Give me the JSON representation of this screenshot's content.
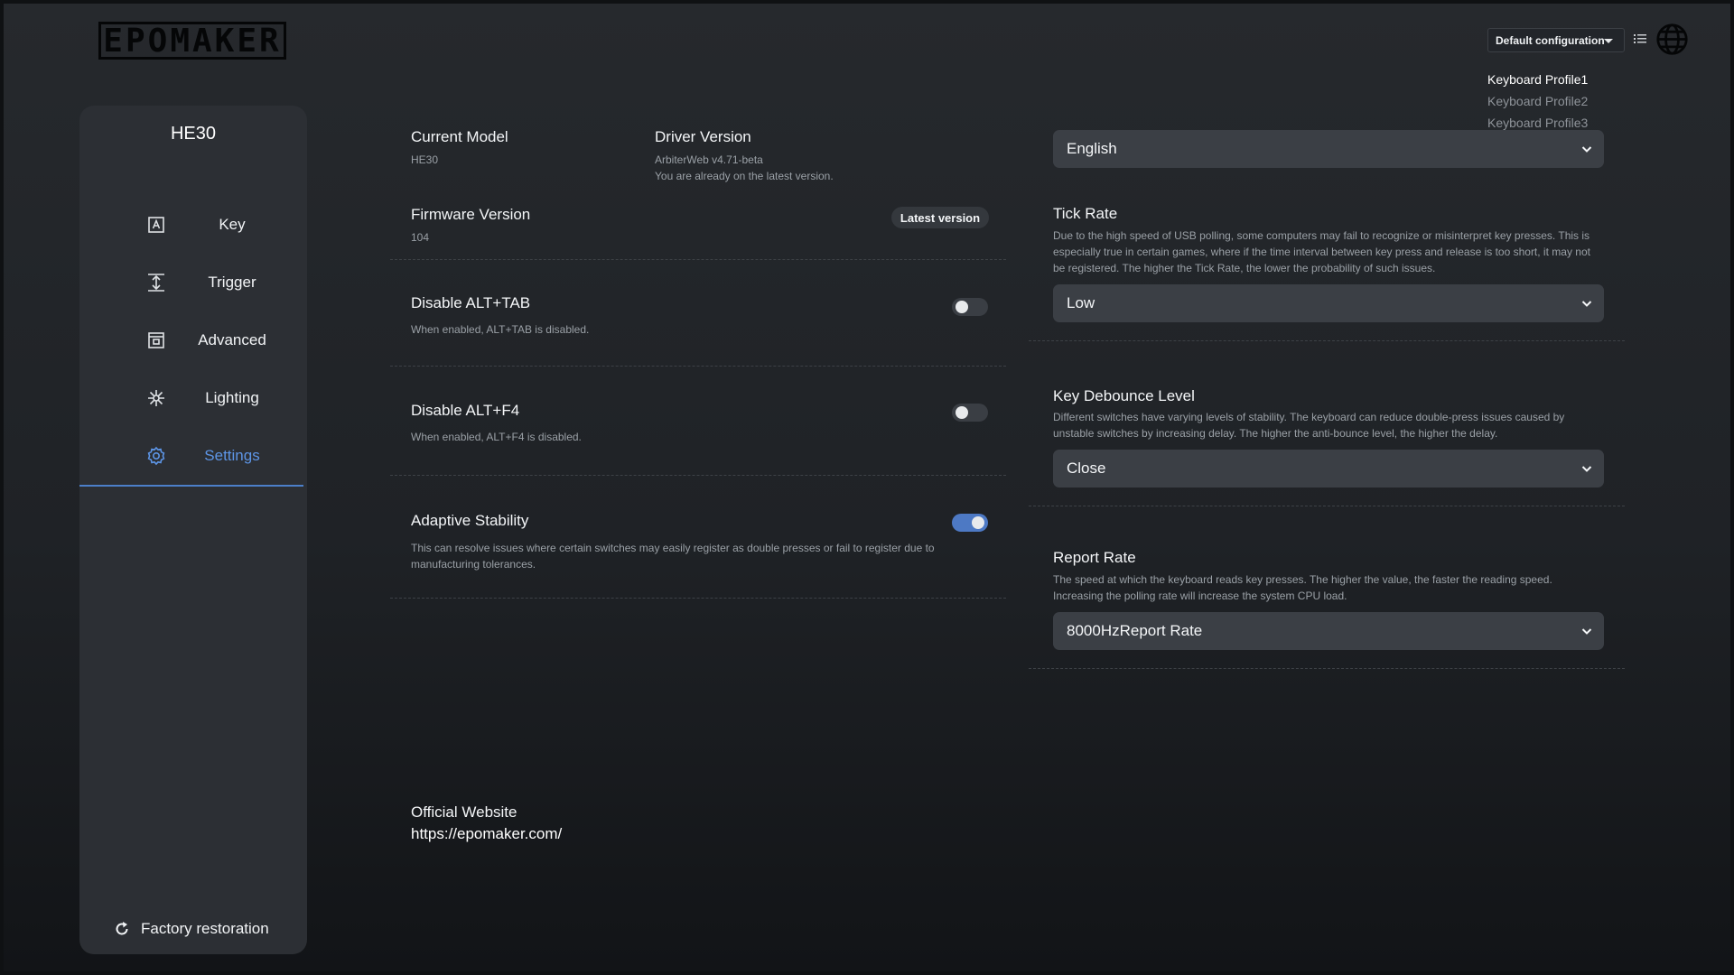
{
  "brand": {
    "logo_text": "EPOMAKER"
  },
  "topbar": {
    "config_value": "Default configuration",
    "profiles": [
      "Keyboard Profile1",
      "Keyboard Profile2",
      "Keyboard Profile3"
    ],
    "active_profile_index": 0
  },
  "sidebar": {
    "device": "HE30",
    "items": [
      {
        "label": "Key",
        "icon": "key-icon"
      },
      {
        "label": "Trigger",
        "icon": "trigger-icon"
      },
      {
        "label": "Advanced",
        "icon": "advanced-icon"
      },
      {
        "label": "Lighting",
        "icon": "lighting-icon"
      },
      {
        "label": "Settings",
        "icon": "settings-gear-icon"
      }
    ],
    "active_item": "Settings",
    "factory_label": "Factory restoration"
  },
  "info": {
    "current_model_label": "Current Model",
    "current_model_value": "HE30",
    "driver_version_label": "Driver Version",
    "driver_version_value": "ArbiterWeb v4.71-beta",
    "driver_status": "You are already on the latest version.",
    "firmware_label": "Firmware Version",
    "firmware_value": "104",
    "firmware_badge": "Latest version"
  },
  "toggles": {
    "alt_tab": {
      "title": "Disable ALT+TAB",
      "desc": "When enabled, ALT+TAB is disabled.",
      "on": false
    },
    "alt_f4": {
      "title": "Disable ALT+F4",
      "desc": "When enabled, ALT+F4 is disabled.",
      "on": false
    },
    "adaptive": {
      "title": "Adaptive Stability",
      "desc": "This can resolve issues where certain switches may easily register as double presses or fail to register due to manufacturing tolerances.",
      "on": true
    }
  },
  "website": {
    "label": "Official Website",
    "url": "https://epomaker.com/"
  },
  "settings": {
    "language_value": "English",
    "tick_rate": {
      "title": "Tick Rate",
      "desc": "Due to the high speed of USB polling, some computers may fail to recognize or misinterpret key presses. This is especially true in certain games, where if the time interval between key press and release is too short, it may not be registered. The higher the Tick Rate, the lower the probability of such issues.",
      "value": "Low"
    },
    "debounce": {
      "title": "Key Debounce Level",
      "desc": "Different switches have varying levels of stability. The keyboard can reduce double-press issues caused by unstable switches by increasing delay. The higher the anti-bounce level, the higher the delay.",
      "value": "Close"
    },
    "report_rate": {
      "title": "Report Rate",
      "desc": "The speed at which the keyboard reads key presses. The higher the value, the faster the reading speed. Increasing the polling rate will increase the system CPU load.",
      "value": "8000HzReport Rate"
    }
  },
  "colors": {
    "accent": "#5d95e6",
    "toggle_on": "#4d79c4",
    "panel": "#2c2f34"
  }
}
